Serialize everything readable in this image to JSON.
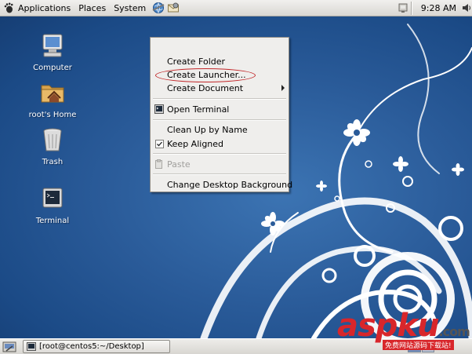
{
  "top_panel": {
    "menus": [
      "Applications",
      "Places",
      "System"
    ],
    "clock": "9:28 AM"
  },
  "desktop_icons": [
    {
      "label": "Computer",
      "icon": "computer-icon"
    },
    {
      "label": "root's Home",
      "icon": "home-folder-icon"
    },
    {
      "label": "Trash",
      "icon": "trash-icon"
    },
    {
      "label": "Terminal",
      "icon": "terminal-icon"
    }
  ],
  "context_menu": {
    "items": [
      {
        "label": "Create Folder",
        "enabled": true
      },
      {
        "label": "Create Launcher...",
        "enabled": true,
        "highlighted": true
      },
      {
        "label": "Create Document",
        "enabled": true,
        "submenu": true
      },
      {
        "label": "Open Terminal",
        "enabled": true,
        "icon": "terminal-icon"
      },
      {
        "label": "Clean Up by Name",
        "enabled": true
      },
      {
        "label": "Keep Aligned",
        "enabled": true,
        "checked": true
      },
      {
        "label": "Paste",
        "enabled": false,
        "icon": "paste-icon"
      },
      {
        "label": "Change Desktop Background",
        "enabled": true
      }
    ]
  },
  "taskbar": {
    "window_button": "[root@centos5:~/Desktop]"
  },
  "watermark": {
    "brand": "aspku",
    "tld": ".com",
    "tagline": "免费网站源码下载站!"
  },
  "colors": {
    "desktop_bg": "#2a5b99",
    "highlight_ellipse": "#c2282a",
    "watermark_red": "#d8262b"
  }
}
